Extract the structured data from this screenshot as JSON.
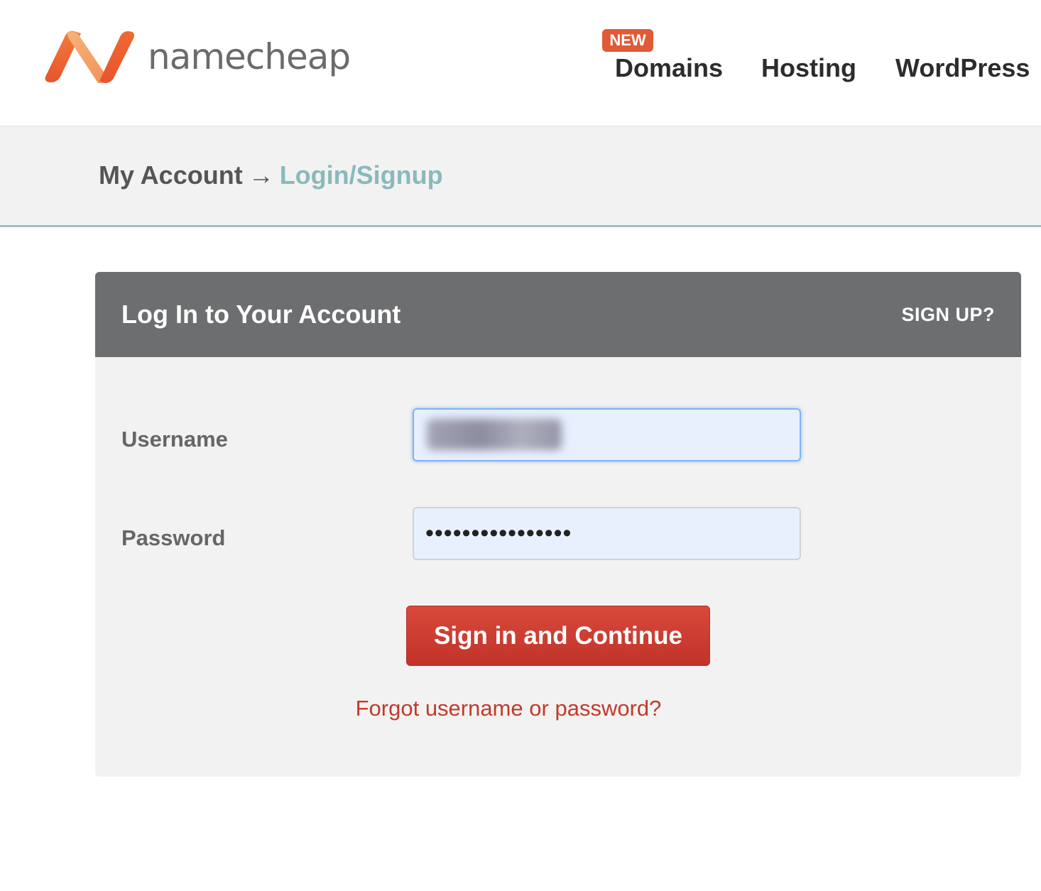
{
  "header": {
    "logo_text": "namecheap",
    "nav": {
      "badge": "NEW",
      "domains": "Domains",
      "hosting": "Hosting",
      "wordpress": "WordPress"
    }
  },
  "breadcrumb": {
    "parent": "My Account",
    "separator": "→",
    "current": "Login/Signup"
  },
  "login": {
    "title": "Log In to Your Account",
    "signup": "SIGN UP?",
    "username_label": "Username",
    "username_value": "",
    "password_label": "Password",
    "password_value": "••••••••••••••••",
    "submit": "Sign in and Continue",
    "forgot": "Forgot username or password?"
  },
  "colors": {
    "brand_orange": "#e15a36",
    "button_red": "#c9392e",
    "link_teal": "#8ab9bb",
    "panel_header": "#6d6e70"
  },
  "icons": {
    "logo": "namecheap-logo-icon"
  }
}
